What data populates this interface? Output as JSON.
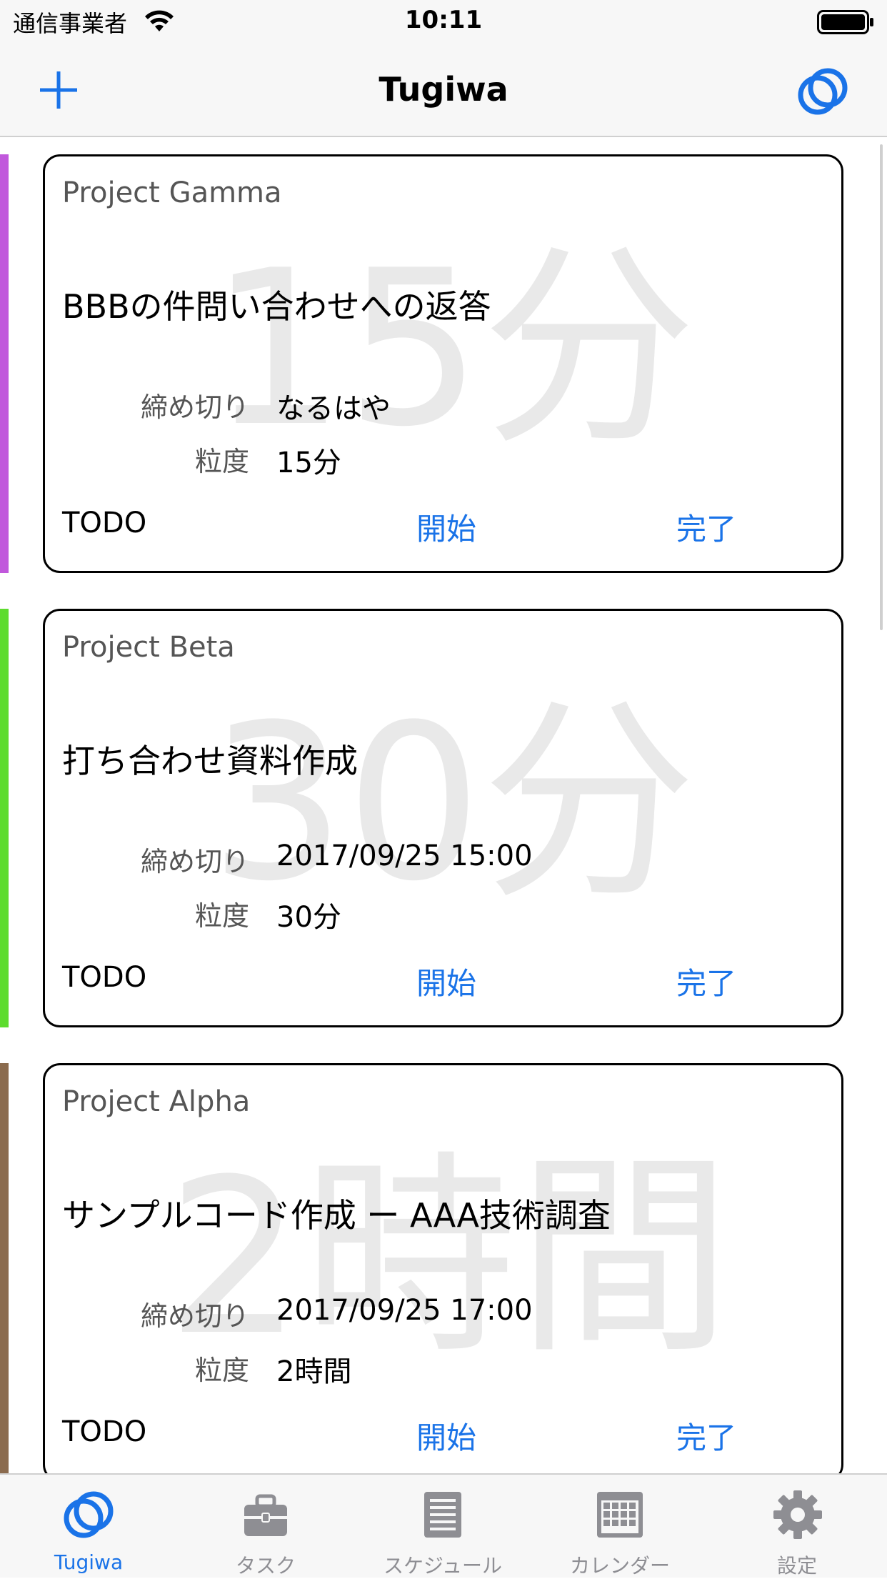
{
  "status_bar": {
    "carrier": "通信事業者",
    "time": "10:11"
  },
  "nav": {
    "title": "Tugiwa"
  },
  "colors": {
    "accent": "#1a73e8",
    "gamma": "#c158dc",
    "beta": "#5ddc2e",
    "alpha": "#8b6b4e"
  },
  "cards": [
    {
      "project": "Project Gamma",
      "title": "BBBの件問い合わせへの返答",
      "watermark": "15分",
      "deadline_label": "締め切り",
      "deadline": "なるはや",
      "granularity_label": "粒度",
      "granularity": "15分",
      "status": "TODO",
      "start": "開始",
      "done": "完了"
    },
    {
      "project": "Project Beta",
      "title": "打ち合わせ資料作成",
      "watermark": "30分",
      "deadline_label": "締め切り",
      "deadline": "2017/09/25 15:00",
      "granularity_label": "粒度",
      "granularity": "30分",
      "status": "TODO",
      "start": "開始",
      "done": "完了"
    },
    {
      "project": "Project Alpha",
      "title": "サンプルコード作成 ー AAA技術調査",
      "watermark": "2時間",
      "deadline_label": "締め切り",
      "deadline": "2017/09/25 17:00",
      "granularity_label": "粒度",
      "granularity": "2時間",
      "status": "TODO",
      "start": "開始",
      "done": "完了"
    }
  ],
  "tabs": [
    {
      "label": "Tugiwa",
      "icon": "tugiwa-logo-icon",
      "active": true
    },
    {
      "label": "タスク",
      "icon": "briefcase-icon",
      "active": false
    },
    {
      "label": "スケジュール",
      "icon": "document-list-icon",
      "active": false
    },
    {
      "label": "カレンダー",
      "icon": "calendar-grid-icon",
      "active": false
    },
    {
      "label": "設定",
      "icon": "gear-icon",
      "active": false
    }
  ]
}
